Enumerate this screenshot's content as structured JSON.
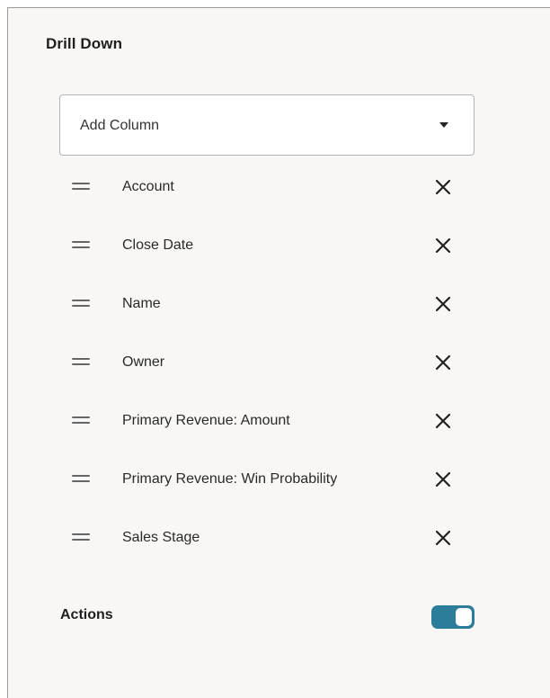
{
  "panel": {
    "title": "Drill Down"
  },
  "add_column": {
    "label": "Add Column",
    "icon": "caret-down-icon"
  },
  "columns": [
    {
      "label": "Account"
    },
    {
      "label": "Close Date"
    },
    {
      "label": "Name"
    },
    {
      "label": "Owner"
    },
    {
      "label": "Primary Revenue: Amount"
    },
    {
      "label": "Primary Revenue: Win Probability"
    },
    {
      "label": "Sales Stage"
    }
  ],
  "actions": {
    "label": "Actions",
    "toggle_on": true,
    "toggle_color": "#2d7d9a"
  }
}
